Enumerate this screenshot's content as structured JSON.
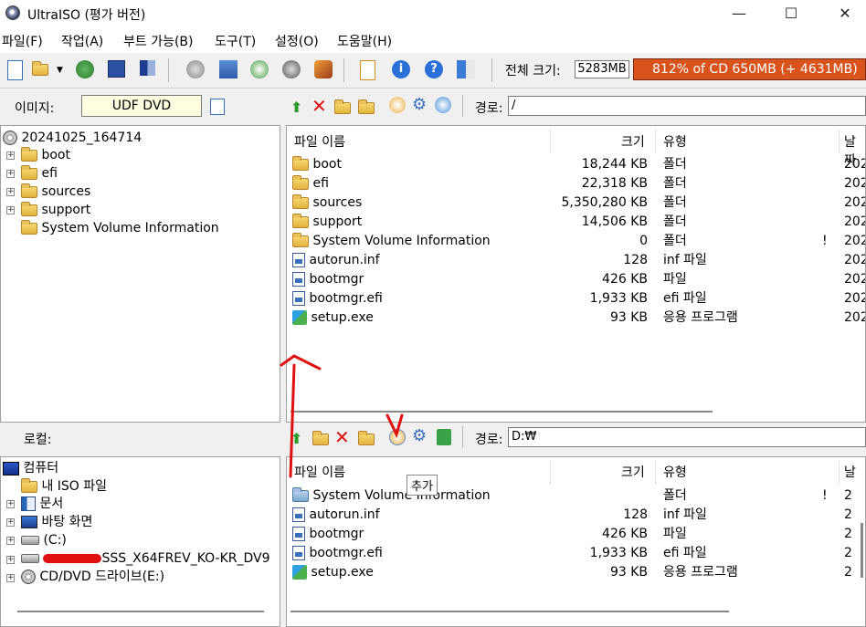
{
  "window": {
    "title": "UltraISO (평가 버전)",
    "minimize": "—",
    "maximize": "☐",
    "close": "✕"
  },
  "menu": [
    "파일(F)",
    "작업(A)",
    "부트 가능(B)",
    "도구(T)",
    "설정(O)",
    "도움말(H)"
  ],
  "toolbar": {
    "total_size_label": "전체 크기:",
    "total_size_value": "5283MB",
    "cd_usage": "812% of CD 650MB (+ 4631MB)",
    "cd_usage_color": "#d9541c"
  },
  "image_pane": {
    "label": "이미지:",
    "format": "UDF DVD",
    "path_label": "경로:",
    "path_value": "/",
    "tree": {
      "root": "20241025_164714",
      "children": [
        "boot",
        "efi",
        "sources",
        "support",
        "System Volume Information"
      ]
    },
    "columns": [
      "파일 이름",
      "크기",
      "유형",
      "날짜"
    ],
    "files": [
      {
        "name": "boot",
        "size": "18,244 KB",
        "type": "폴더",
        "flag": "",
        "date": "202",
        "icon": "folder-icon"
      },
      {
        "name": "efi",
        "size": "22,318 KB",
        "type": "폴더",
        "flag": "",
        "date": "202",
        "icon": "folder-icon"
      },
      {
        "name": "sources",
        "size": "5,350,280 KB",
        "type": "폴더",
        "flag": "",
        "date": "202",
        "icon": "folder-icon"
      },
      {
        "name": "support",
        "size": "14,506 KB",
        "type": "폴더",
        "flag": "",
        "date": "202",
        "icon": "folder-icon"
      },
      {
        "name": "System Volume Information",
        "size": "0",
        "type": "폴더",
        "flag": "!",
        "date": "202",
        "icon": "folder-icon"
      },
      {
        "name": "autorun.inf",
        "size": "128",
        "type": "inf 파일",
        "flag": "",
        "date": "202",
        "icon": "file-icon"
      },
      {
        "name": "bootmgr",
        "size": "426 KB",
        "type": "파일",
        "flag": "",
        "date": "202",
        "icon": "file-icon"
      },
      {
        "name": "bootmgr.efi",
        "size": "1,933 KB",
        "type": "efi 파일",
        "flag": "",
        "date": "202",
        "icon": "file-icon"
      },
      {
        "name": "setup.exe",
        "size": "93 KB",
        "type": "응용 프로그램",
        "flag": "",
        "date": "202",
        "icon": "exe-icon"
      }
    ]
  },
  "local_pane": {
    "label": "로컬:",
    "path_label": "경로:",
    "path_value": "D:₩",
    "tooltip": "추가",
    "tree": [
      {
        "label": "컴퓨터",
        "icon": "computer-icon"
      },
      {
        "label": "내 ISO 파일",
        "icon": "folder-icon"
      },
      {
        "label": "문서",
        "icon": "documents-icon"
      },
      {
        "label": "바탕 화면",
        "icon": "desktop-icon"
      },
      {
        "label": "(C:)",
        "icon": "drive-icon"
      },
      {
        "label": "SSS_X64FREV_KO-KR_DV9",
        "icon": "drive-icon"
      },
      {
        "label": "CD/DVD 드라이브(E:)",
        "icon": "cd-drive-icon"
      }
    ],
    "columns": [
      "파일 이름",
      "크기",
      "유형",
      "날"
    ],
    "files": [
      {
        "name": "System Volume Information",
        "size": "",
        "type": "폴더",
        "flag": "!",
        "date": "2",
        "icon": "folder-icon"
      },
      {
        "name": "autorun.inf",
        "size": "128",
        "type": "inf 파일",
        "flag": "",
        "date": "2",
        "icon": "file-icon"
      },
      {
        "name": "bootmgr",
        "size": "426 KB",
        "type": "파일",
        "flag": "",
        "date": "2",
        "icon": "file-icon"
      },
      {
        "name": "bootmgr.efi",
        "size": "1,933 KB",
        "type": "efi 파일",
        "flag": "",
        "date": "2",
        "icon": "file-icon"
      },
      {
        "name": "setup.exe",
        "size": "93 KB",
        "type": "응용 프로그램",
        "flag": "",
        "date": "2",
        "icon": "exe-icon"
      }
    ]
  },
  "annotation_color": "#e01010"
}
